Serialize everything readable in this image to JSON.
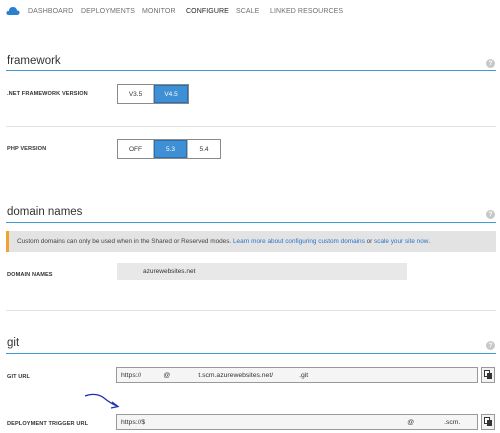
{
  "nav": {
    "items": [
      "DASHBOARD",
      "DEPLOYMENTS",
      "MONITOR",
      "CONFIGURE",
      "SCALE",
      "LINKED RESOURCES"
    ],
    "active": "CONFIGURE"
  },
  "framework": {
    "title": "framework",
    "net_label": ".NET FRAMEWORK VERSION",
    "net_options": [
      "V3.5",
      "V4.5"
    ],
    "net_selected": "V4.5",
    "php_label": "PHP VERSION",
    "php_options": [
      "OFF",
      "5.3",
      "5.4"
    ],
    "php_selected": "5.3"
  },
  "domains": {
    "title": "domain names",
    "notice_text": "Custom domains can only be used when in the Shared or Reserved modes.",
    "notice_link1": "Learn more about configuring custom domains",
    "notice_or": "or",
    "notice_link2": "scale your site now",
    "notice_end": ".",
    "label": "DOMAIN NAMES",
    "value": "azurewebsites.net"
  },
  "git": {
    "title": "git",
    "url_label": "GIT URL",
    "url_parts": [
      "https://",
      "@",
      "t.scm.azurewebsites.net/",
      ".git"
    ],
    "trigger_label": "DEPLOYMENT TRIGGER URL",
    "trigger_parts": [
      "https://$",
      "@",
      ".scm."
    ]
  },
  "help_glyph": "?",
  "colors": {
    "accent": "#3e9cd6",
    "selected": "#3e8fd4",
    "notice_bar": "#f0a430",
    "link": "#2a75c7"
  }
}
